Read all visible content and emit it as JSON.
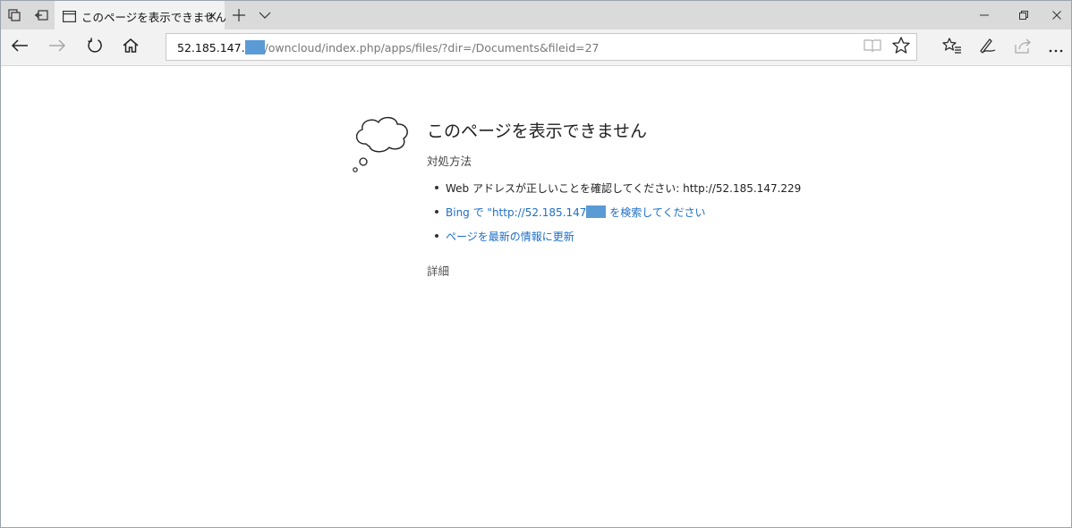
{
  "tab": {
    "title": "このページを表示できません"
  },
  "address": {
    "host": "52.185.147.",
    "path": "/owncloud/index.php/apps/files/?dir=/Documents&fileid=27"
  },
  "error": {
    "title": "このページを表示できません",
    "subtitle": "対処方法",
    "item_check": "Web アドレスが正しいことを確認してください: http://52.185.147.229",
    "item_bing_prefix": "Bing で \"http://52.185.147",
    "item_bing_suffix": " を検索してください",
    "item_refresh": "ページを最新の情報に更新",
    "details": "詳細"
  },
  "colors": {
    "link": "#1e6ec8",
    "mask": "#5b9bd5",
    "titlebar": "#dadada",
    "toolbar": "#f2f2f2"
  },
  "icons": {
    "tabs_aside": "tabs-aside-icon",
    "show_tabs": "show-tabs-icon",
    "tab_page": "page-icon",
    "close": "close-icon",
    "new_tab": "plus-icon",
    "tab_preview": "chevron-down-icon",
    "minimize": "minimize-icon",
    "restore": "restore-icon",
    "window_close": "close-icon",
    "back": "back-arrow-icon",
    "forward": "forward-arrow-icon",
    "refresh": "refresh-icon",
    "home": "home-icon",
    "reading_view": "book-icon",
    "favorite": "star-icon",
    "favorites_hub": "favorites-list-icon",
    "web_note": "pen-icon",
    "share": "share-icon",
    "more": "more-icon",
    "cloud": "thought-cloud-icon"
  }
}
